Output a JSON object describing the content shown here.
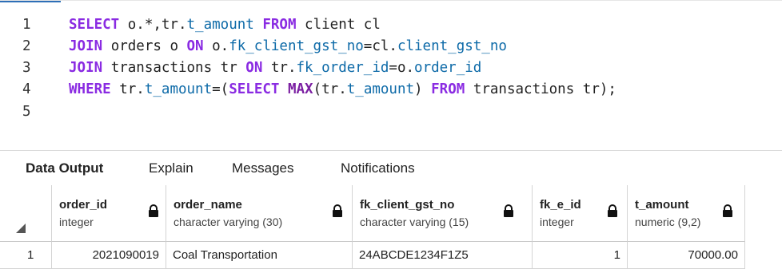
{
  "editor": {
    "lines": [
      {
        "n": "1",
        "parts": [
          {
            "t": "SELECT",
            "c": "kw"
          },
          {
            "t": " o.*,tr.",
            "c": ""
          },
          {
            "t": "t_amount",
            "c": "id"
          },
          {
            "t": " ",
            "c": ""
          },
          {
            "t": "FROM",
            "c": "kw"
          },
          {
            "t": " client cl",
            "c": ""
          }
        ]
      },
      {
        "n": "2",
        "parts": [
          {
            "t": "JOIN",
            "c": "kw"
          },
          {
            "t": " orders o ",
            "c": ""
          },
          {
            "t": "ON",
            "c": "kw"
          },
          {
            "t": " o.",
            "c": ""
          },
          {
            "t": "fk_client_gst_no",
            "c": "id"
          },
          {
            "t": "=cl.",
            "c": ""
          },
          {
            "t": "client_gst_no",
            "c": "id"
          }
        ]
      },
      {
        "n": "3",
        "parts": [
          {
            "t": "JOIN",
            "c": "kw"
          },
          {
            "t": " transactions tr ",
            "c": ""
          },
          {
            "t": "ON",
            "c": "kw"
          },
          {
            "t": " tr.",
            "c": ""
          },
          {
            "t": "fk_order_id",
            "c": "id"
          },
          {
            "t": "=o.",
            "c": ""
          },
          {
            "t": "order_id",
            "c": "id"
          }
        ]
      },
      {
        "n": "4",
        "parts": [
          {
            "t": "WHERE",
            "c": "kw"
          },
          {
            "t": " tr.",
            "c": ""
          },
          {
            "t": "t_amount",
            "c": "id"
          },
          {
            "t": "=(",
            "c": ""
          },
          {
            "t": "SELECT",
            "c": "kw"
          },
          {
            "t": " ",
            "c": ""
          },
          {
            "t": "MAX",
            "c": "kw2"
          },
          {
            "t": "(tr.",
            "c": ""
          },
          {
            "t": "t_amount",
            "c": "id"
          },
          {
            "t": ") ",
            "c": ""
          },
          {
            "t": "FROM",
            "c": "kw"
          },
          {
            "t": " transactions tr);",
            "c": ""
          }
        ]
      },
      {
        "n": "5",
        "parts": []
      }
    ]
  },
  "tabs": [
    {
      "label": "Data Output",
      "active": true
    },
    {
      "label": "Explain",
      "active": false
    },
    {
      "label": "Messages",
      "active": false
    },
    {
      "label": "Notifications",
      "active": false
    }
  ],
  "grid": {
    "columns": [
      {
        "name": "order_id",
        "type": "integer"
      },
      {
        "name": "order_name",
        "type": "character varying (30)"
      },
      {
        "name": "fk_client_gst_no",
        "type": "character varying (15)"
      },
      {
        "name": "fk_e_id",
        "type": "integer"
      },
      {
        "name": "t_amount",
        "type": "numeric (9,2)"
      }
    ],
    "rows": [
      {
        "num": "1",
        "cells": [
          "2021090019",
          "Coal Transportation",
          "24ABCDE1234F1Z5",
          "1",
          "70000.00"
        ]
      }
    ]
  }
}
